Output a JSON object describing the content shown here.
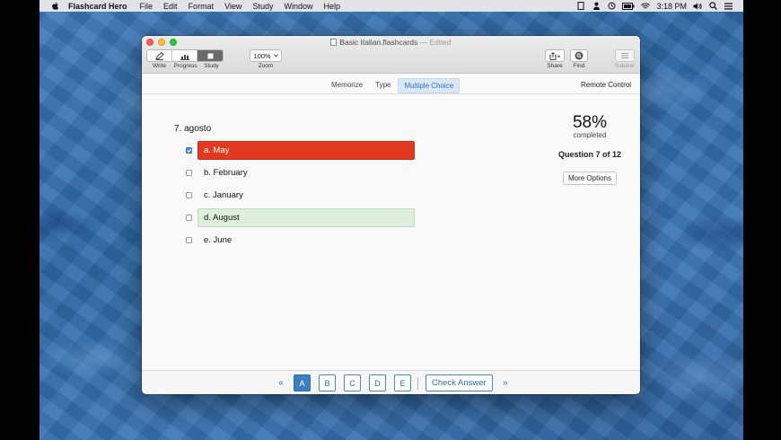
{
  "menubar": {
    "app_name": "Flashcard Hero",
    "items": [
      "File",
      "Edit",
      "Format",
      "View",
      "Study",
      "Window",
      "Help"
    ],
    "time": "3:18 PM",
    "icons": [
      "document-icon",
      "person-icon",
      "time-machine-icon",
      "battery-icon",
      "wifi-icon",
      "volume-icon",
      "search-icon",
      "list-icon"
    ]
  },
  "window": {
    "title": "Basic Italian.flashcards",
    "edited": "— Edited",
    "toolbar": {
      "write_label": "Write",
      "progress_label": "Progress",
      "study_label": "Study",
      "zoom_value": "100%",
      "zoom_label": "Zoom",
      "share_label": "Share",
      "find_label": "Find",
      "sidebar_label": "Sidebar"
    },
    "modes": {
      "memorize": "Memorize",
      "type": "Type",
      "multiple_choice": "Multiple Choice",
      "active": "Multiple Choice"
    },
    "remote_control": "Remote Control"
  },
  "quiz": {
    "question": "7. agosto",
    "choices": [
      {
        "label": "a. May",
        "checked": true,
        "state": "wrong"
      },
      {
        "label": "b. February",
        "checked": false,
        "state": "none"
      },
      {
        "label": "c. January",
        "checked": false,
        "state": "none"
      },
      {
        "label": "d. August",
        "checked": false,
        "state": "correct"
      },
      {
        "label": "e. June",
        "checked": false,
        "state": "none"
      }
    ],
    "percent": "58%",
    "completed_label": "completed",
    "question_count": "Question 7 of 12",
    "more_options": "More Options"
  },
  "nav": {
    "prev": "«",
    "next": "»",
    "letters": [
      "A",
      "B",
      "C",
      "D",
      "E"
    ],
    "active_letter": "A",
    "check_answer": "Check Answer"
  },
  "colors": {
    "wrong": "#e1391f",
    "correct": "#def0dd",
    "accent": "#3b7fc1"
  }
}
